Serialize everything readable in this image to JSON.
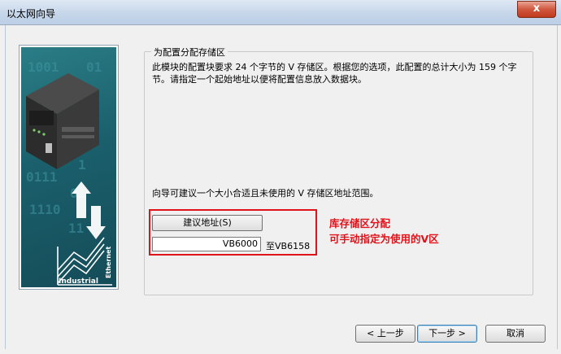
{
  "window": {
    "title": "以太网向导",
    "close_glyph": "x"
  },
  "group": {
    "legend": "为配置分配存储区",
    "description": "此模块的配置块要求 24 个字节的 V 存储区。根据您的选项，此配置的总计大小为 159 个字节。请指定一个起始地址以便将配置信息放入数据块。",
    "hint": "向导可建议一个大小合适且未使用的 V 存储区地址范围。",
    "suggest_button": "建议地址(S)",
    "start_address": "VB6000",
    "end_address_label": "至VB6158"
  },
  "annotation": {
    "line1": "库存储区分配",
    "line2": "可手动指定为使用的V区",
    "color": "#e0121a"
  },
  "side_image": {
    "binary_text": "1001 101 0110 01 1011 01 1110 0111 01",
    "brand_label": "Industrial",
    "brand_label2": "Ethernet"
  },
  "buttons": {
    "prev": "< 上一步",
    "next": "下一步 >",
    "cancel": "取消"
  }
}
